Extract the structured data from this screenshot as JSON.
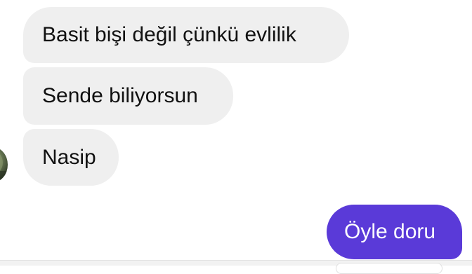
{
  "conversation": {
    "messages": [
      {
        "direction": "incoming",
        "text": "Basit bişi değil çünkü evlilik"
      },
      {
        "direction": "incoming",
        "text": "Sende biliyorsun"
      },
      {
        "direction": "incoming",
        "text": "Nasip"
      },
      {
        "direction": "outgoing",
        "text": "Öyle doru"
      }
    ]
  },
  "colors": {
    "incoming_bubble": "#efefef",
    "outgoing_bubble": "#5a3ad8",
    "incoming_text": "#111111",
    "outgoing_text": "#ffffff"
  },
  "icons": {
    "sender_avatar": "contact-avatar"
  }
}
